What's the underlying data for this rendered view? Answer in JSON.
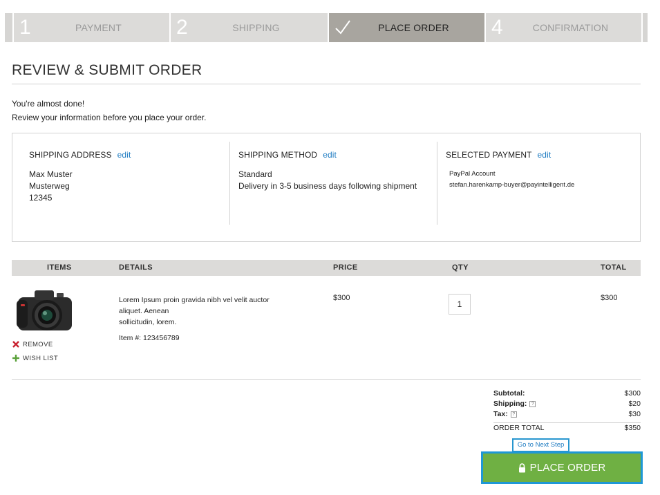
{
  "steps": [
    {
      "num": "1",
      "label": "PAYMENT"
    },
    {
      "num": "2",
      "label": "SHIPPING"
    },
    {
      "num": "",
      "label": "PLACE ORDER",
      "icon": "checkmark-icon"
    },
    {
      "num": "4",
      "label": "CONFIRMATION"
    }
  ],
  "page": {
    "title": "REVIEW & SUBMIT ORDER",
    "intro_line1": "You're almost done!",
    "intro_line2": "Review your information before you place your order."
  },
  "shipping_address": {
    "heading": "SHIPPING ADDRESS",
    "edit": "edit",
    "name": "Max Muster",
    "street": "Musterweg",
    "zip": "12345"
  },
  "shipping_method": {
    "heading": "SHIPPING METHOD",
    "edit": "edit",
    "method": "Standard",
    "delivery": "Delivery in 3-5 business days following shipment"
  },
  "payment": {
    "heading": "SELECTED PAYMENT",
    "edit": "edit",
    "type": "PayPal Account",
    "email": "stefan.harenkamp-buyer@payintelligent.de"
  },
  "table": {
    "headers": {
      "items": "ITEMS",
      "details": "DETAILS",
      "price": "PRICE",
      "qty": "QTY",
      "total": "TOTAL"
    }
  },
  "item": {
    "image": "camera-image",
    "remove_label": "REMOVE",
    "wishlist_label": "WISH LIST",
    "desc_line1": "Lorem Ipsum proin gravida nibh vel velit auctor",
    "desc_line2": "aliquet. Aenean",
    "desc_line3": "sollicitudin, lorem.",
    "sku": "Item #: 123456789",
    "price": "$300",
    "qty": "1",
    "total": "$300"
  },
  "summary": {
    "subtotal_label": "Subtotal:",
    "subtotal_value": "$300",
    "shipping_label": "Shipping:",
    "shipping_value": "$20",
    "tax_label": "Tax:",
    "tax_value": "$30",
    "help_glyph": "?",
    "order_total_label": "ORDER TOTAL",
    "order_total_value": "$350"
  },
  "actions": {
    "next_step": "Go to Next Step",
    "place_order": "PLACE ORDER"
  },
  "colors": {
    "accent_blue": "#1f7cc2",
    "button_green": "#6fb043",
    "focus_blue": "#1f98d6",
    "step_active": "#a8a59f"
  }
}
